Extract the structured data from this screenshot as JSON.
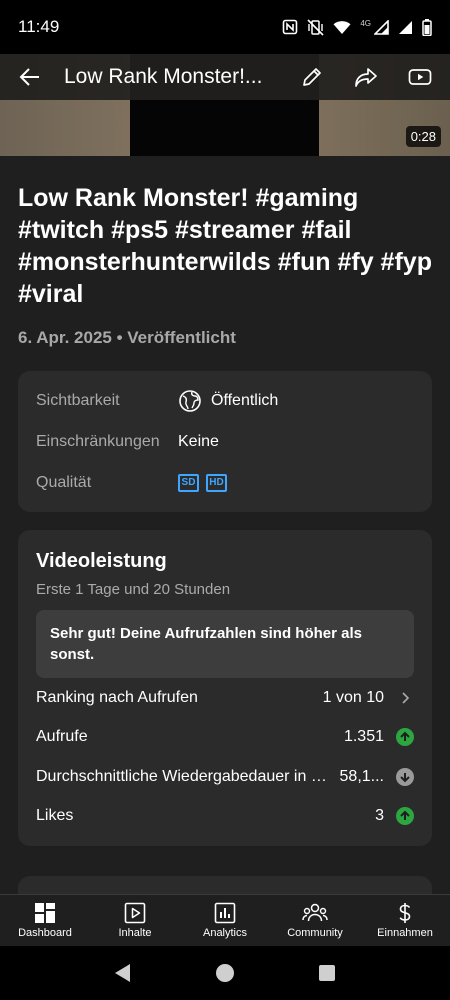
{
  "status": {
    "time": "11:49",
    "network": "4G"
  },
  "video": {
    "duration": "0:28"
  },
  "topbar": {
    "title": "Low Rank Monster!..."
  },
  "title": "Low Rank Monster!  #gaming #twitch #ps5 #streamer #fail #monsterhunterwilds #fun #fy #fyp #viral",
  "subtitle": "6. Apr. 2025 • Veröffentlicht",
  "details": {
    "visibility_label": "Sichtbarkeit",
    "visibility_value": "Öffentlich",
    "restrictions_label": "Einschränkungen",
    "restrictions_value": "Keine",
    "quality_label": "Qualität",
    "quality_badges": [
      "SD",
      "HD"
    ]
  },
  "performance": {
    "title": "Videoleistung",
    "period": "Erste 1 Tage und 20 Stunden",
    "message": "Sehr gut! Deine Aufrufzahlen sind höher als sonst.",
    "ranking_label": "Ranking nach Aufrufen",
    "ranking_value": "1 von 10",
    "views_label": "Aufrufe",
    "views_value": "1.351",
    "watchtime_label": "Durchschnittliche Wiedergabedauer in P...",
    "watchtime_value": "58,1...",
    "likes_label": "Likes",
    "likes_value": "3"
  },
  "nav": {
    "dashboard": "Dashboard",
    "content": "Inhalte",
    "analytics": "Analytics",
    "community": "Community",
    "earnings": "Einnahmen"
  },
  "colors": {
    "accent_blue": "#3ea6ff",
    "trend_up": "#2ba640",
    "trend_neutral": "#9a9a9a",
    "card": "#2b2b2b",
    "background": "#1f1f1f"
  }
}
